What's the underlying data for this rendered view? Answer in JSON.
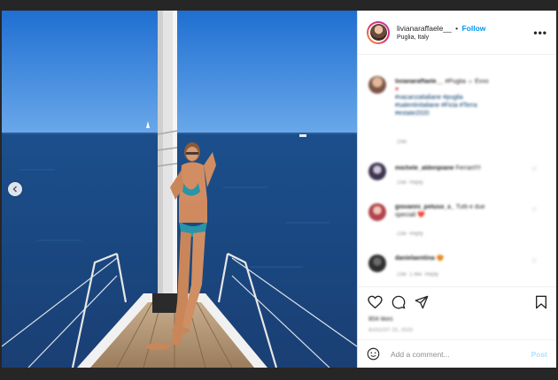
{
  "post": {
    "username": "livianaraffaele__",
    "separator": "•",
    "follow_label": "Follow",
    "location": "Puglia, Italy",
    "more_label": "•••"
  },
  "caption": {
    "username": "livianaraffaele__",
    "text_line1": "#Puglia ☼ Evvo",
    "text_line2": "#vacanzaitaliane #puglia",
    "text_line3": "#salentinitaliane #Ficia #Terra",
    "text_line4": "#estate2020",
    "age": "23w"
  },
  "comments": [
    {
      "username": "michele_aldenpiane",
      "text": "Ferrari!!!!",
      "age": "23w",
      "reply": "Reply"
    },
    {
      "username": "giovanni_peluso_s_",
      "text": "Tutti e due",
      "text2": "speciali ❤️",
      "age": "23w",
      "reply": "Reply"
    },
    {
      "username": "danielaentina",
      "text": "😍",
      "age": "23w",
      "likes": "1 like",
      "reply": "Reply"
    }
  ],
  "likes_text": "804 likes",
  "date_text": "AUGUST 23, 2020",
  "add_comment": {
    "placeholder": "Add a comment...",
    "post_label": "Post"
  },
  "icons": {
    "like": "heart-icon",
    "comment": "comment-icon",
    "share": "share-icon",
    "save": "bookmark-icon",
    "emoji": "emoji-icon",
    "prev": "chevron-left-icon"
  },
  "colors": {
    "follow": "#0095f6",
    "post_disabled": "#b2dffc",
    "backdrop": "#262626"
  }
}
